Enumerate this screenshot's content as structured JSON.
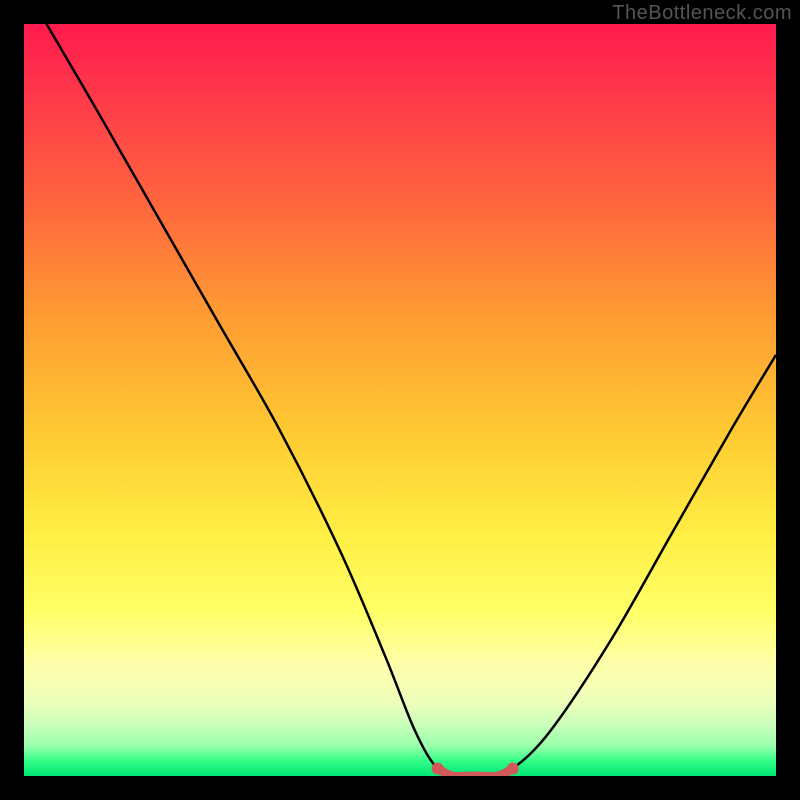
{
  "watermark": "TheBottleneck.com",
  "chart_data": {
    "type": "line",
    "title": "",
    "xlabel": "",
    "ylabel": "",
    "xlim": [
      0,
      100
    ],
    "ylim": [
      0,
      100
    ],
    "series": [
      {
        "name": "bottleneck-curve",
        "x": [
          3,
          10,
          18,
          26,
          34,
          42,
          48,
          52,
          55,
          58,
          62,
          65,
          70,
          78,
          86,
          94,
          100
        ],
        "y": [
          100,
          88,
          74,
          60,
          46,
          30,
          16,
          6,
          1,
          0,
          0,
          1,
          6,
          18,
          32,
          46,
          56
        ]
      },
      {
        "name": "highlight-segment",
        "x": [
          55,
          57,
          60,
          63,
          65
        ],
        "y": [
          1,
          0,
          0,
          0,
          1
        ]
      }
    ],
    "colors": {
      "curve": "#000000",
      "highlight": "#d05a5a",
      "gradient_top": "#ff1a4d",
      "gradient_bottom": "#00e676"
    }
  }
}
